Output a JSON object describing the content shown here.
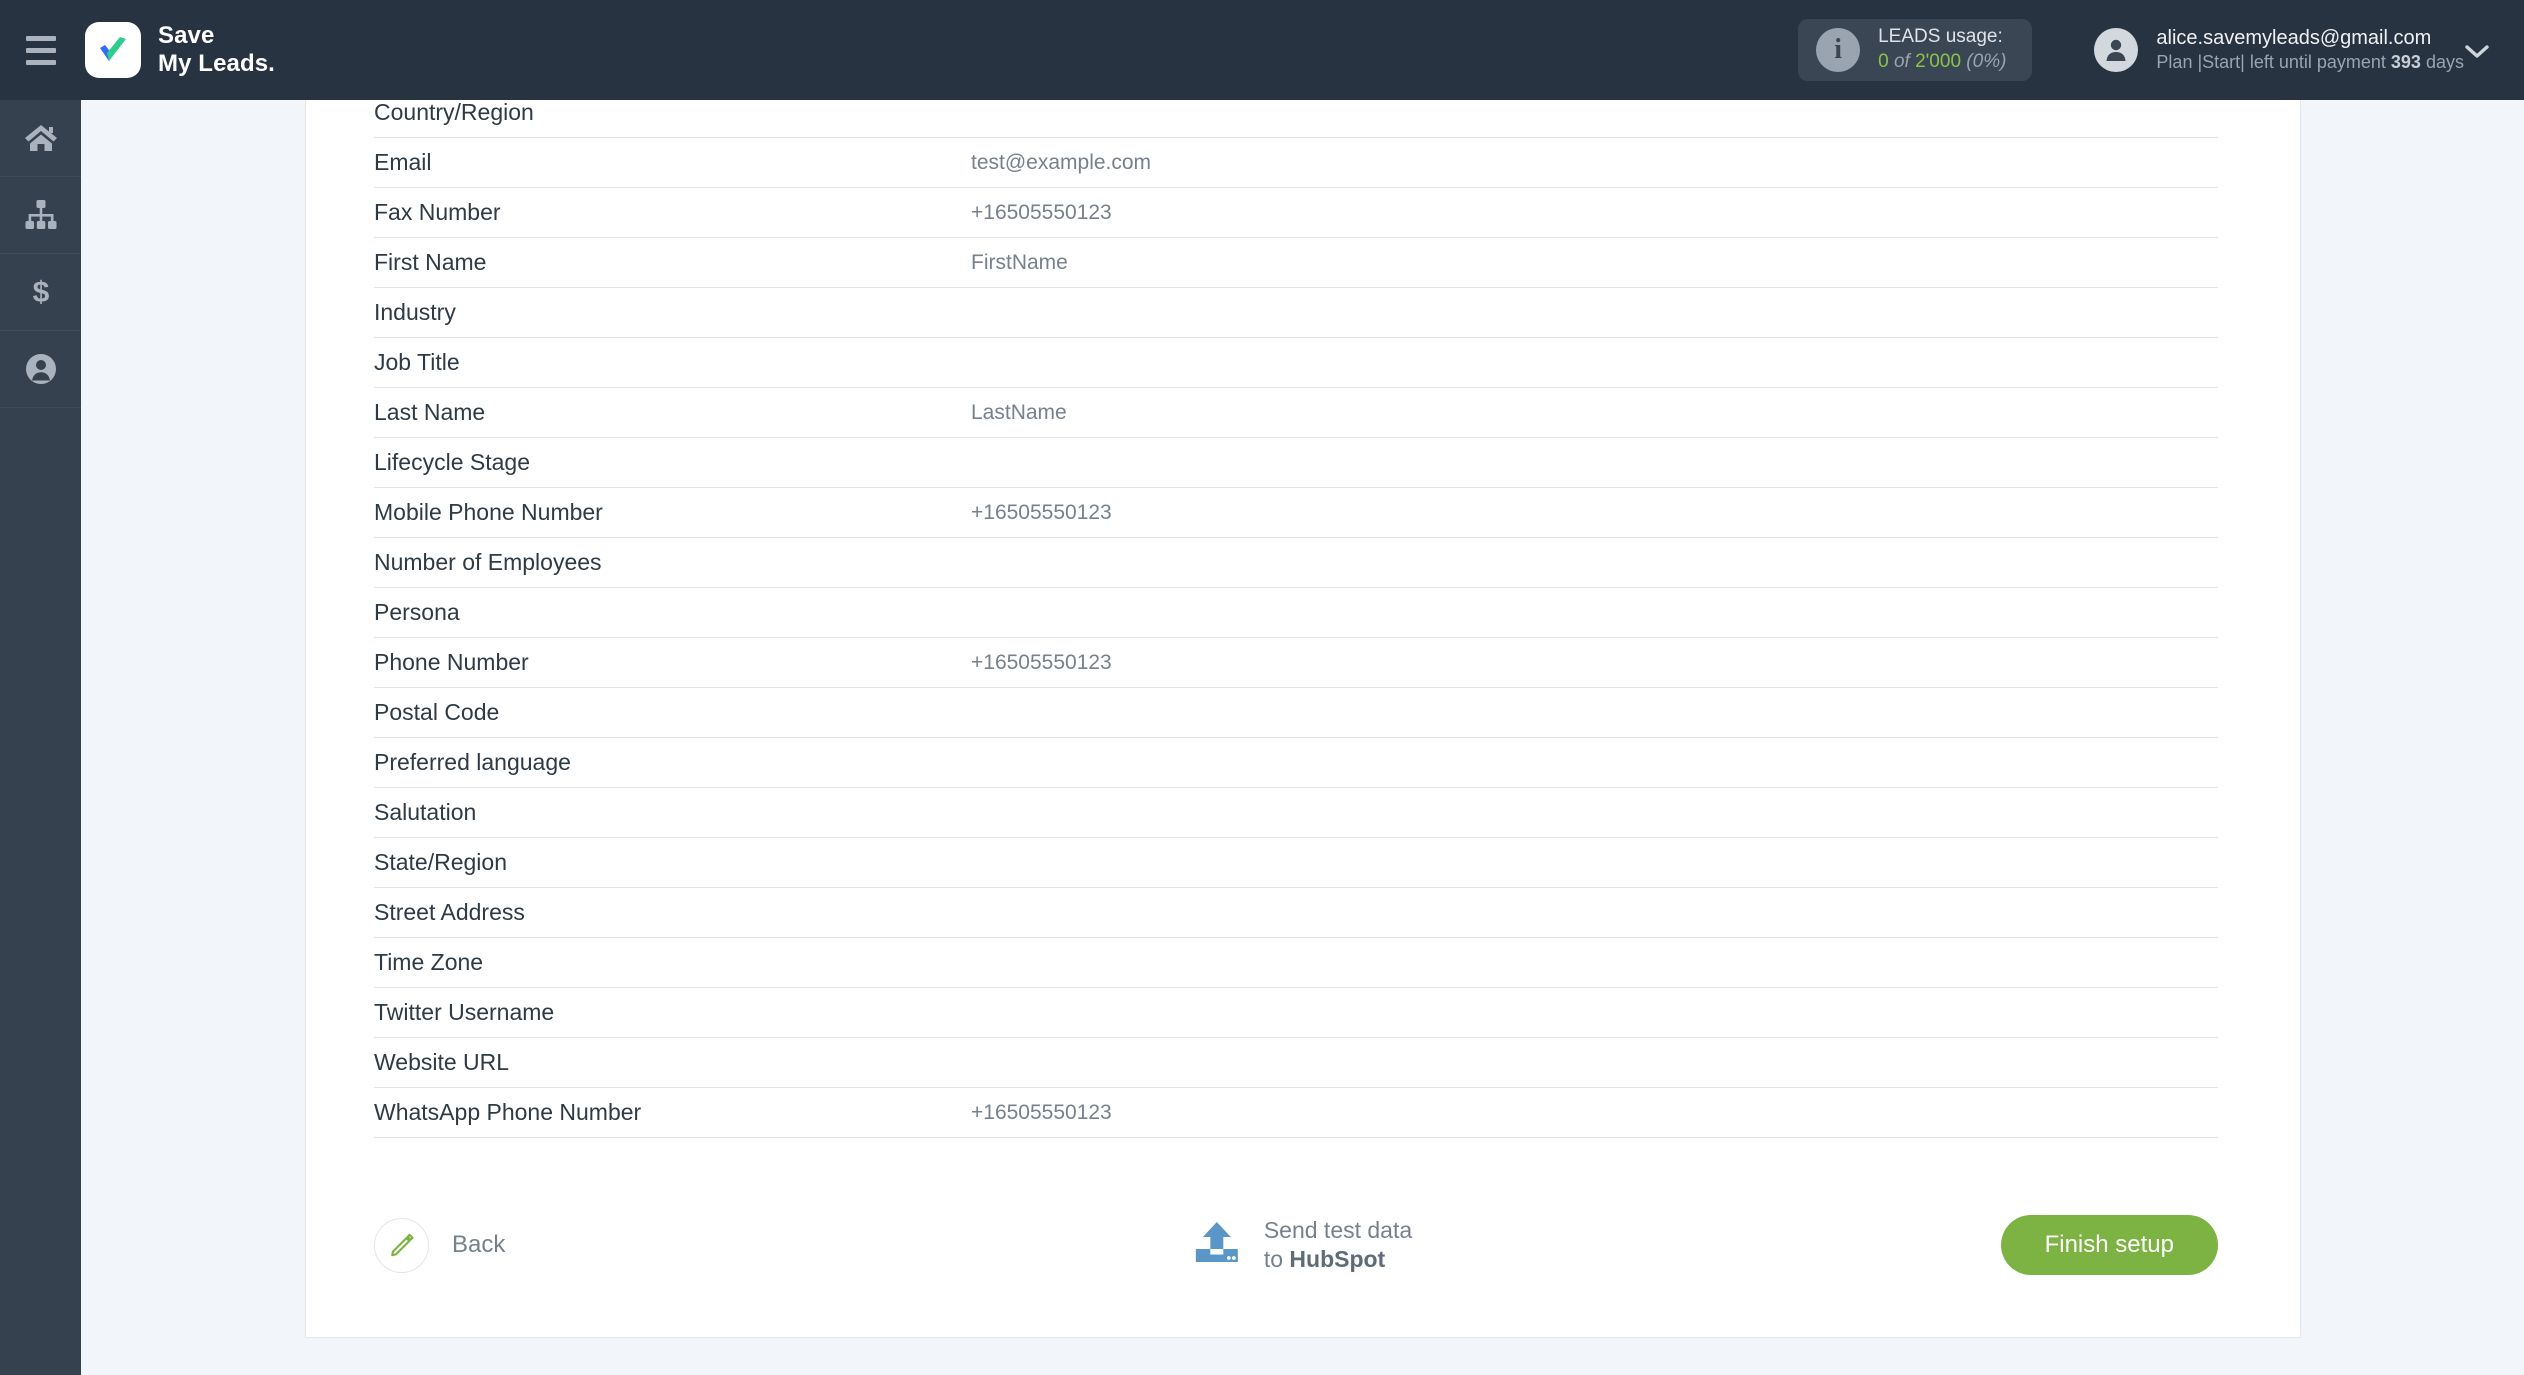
{
  "header": {
    "menu_icon": "hamburger-icon",
    "brand": {
      "line1": "Save",
      "line2": "My Leads."
    },
    "usage": {
      "icon": "info-icon",
      "title": "LEADS usage:",
      "used": "0",
      "of": "of",
      "total": "2'000",
      "percent": "(0%)",
      "accent_color": "#8bc34a"
    },
    "account": {
      "avatar_icon": "user-avatar-icon",
      "email": "alice.savemyleads@gmail.com",
      "plan_prefix": "Plan |Start| left until payment",
      "days_value": "393",
      "days_suffix": "days"
    },
    "caret_icon": "chevron-down-icon"
  },
  "sidebar": {
    "items": [
      {
        "name": "home",
        "icon": "home-icon"
      },
      {
        "name": "connections",
        "icon": "sitemap-icon"
      },
      {
        "name": "billing",
        "icon": "dollar-icon"
      },
      {
        "name": "account",
        "icon": "user-circle-icon"
      }
    ]
  },
  "main": {
    "fields": [
      {
        "label": "Country/Region",
        "value": ""
      },
      {
        "label": "Email",
        "value": "test@example.com"
      },
      {
        "label": "Fax Number",
        "value": "+16505550123"
      },
      {
        "label": "First Name",
        "value": "FirstName"
      },
      {
        "label": "Industry",
        "value": ""
      },
      {
        "label": "Job Title",
        "value": ""
      },
      {
        "label": "Last Name",
        "value": "LastName"
      },
      {
        "label": "Lifecycle Stage",
        "value": ""
      },
      {
        "label": "Mobile Phone Number",
        "value": "+16505550123"
      },
      {
        "label": "Number of Employees",
        "value": ""
      },
      {
        "label": "Persona",
        "value": ""
      },
      {
        "label": "Phone Number",
        "value": "+16505550123"
      },
      {
        "label": "Postal Code",
        "value": ""
      },
      {
        "label": "Preferred language",
        "value": ""
      },
      {
        "label": "Salutation",
        "value": ""
      },
      {
        "label": "State/Region",
        "value": ""
      },
      {
        "label": "Street Address",
        "value": ""
      },
      {
        "label": "Time Zone",
        "value": ""
      },
      {
        "label": "Twitter Username",
        "value": ""
      },
      {
        "label": "Website URL",
        "value": ""
      },
      {
        "label": "WhatsApp Phone Number",
        "value": "+16505550123"
      }
    ]
  },
  "footer": {
    "back": {
      "icon": "pencil-icon",
      "label": "Back",
      "icon_color": "#7cb342"
    },
    "send_test": {
      "icon": "upload-icon",
      "icon_color": "#5b96c8",
      "line1": "Send test data",
      "line2_prefix": "to",
      "line2_destination": "HubSpot"
    },
    "finish": {
      "label": "Finish setup",
      "color": "#7cb342"
    }
  }
}
